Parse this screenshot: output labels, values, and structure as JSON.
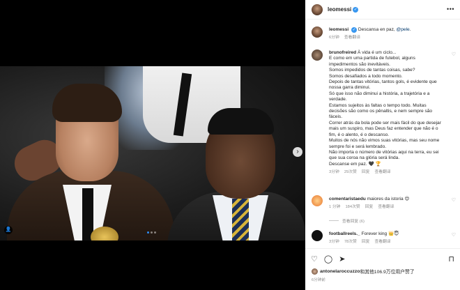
{
  "post_author": {
    "username": "leomessi",
    "verified": true
  },
  "header": {
    "more_icon": "more-horizontal-icon"
  },
  "media": {
    "next_icon": "chevron-right-icon",
    "tag_icon": "user-tag-icon",
    "slide_count": 3,
    "active_slide": 1
  },
  "caption": {
    "username": "leomessi",
    "text": "Descansa en paz, ",
    "mention": "@pele",
    "text_end": ".",
    "time": "6分钟",
    "translate": "查看翻译"
  },
  "comments": [
    {
      "username": "brunofreired",
      "lines": [
        "À vida é um ciclo...",
        "E como em uma partida de futebol, alguns",
        "impedimentos são inevitáveis.",
        "Somos impedidos de tantas coisas, sabe?",
        "Somos desafiados a todo momento.",
        "Depois de tantas vitórias, tantos gols, é evidente que",
        "nossa garra diminui.",
        "Só que isso não diminui a história, a trajetória e a",
        "verdade.",
        "Estamos sujeitos às faltas o tempo todo. Muitas",
        "decisões são como os pênaltis, e nem sempre são",
        "fáceis.",
        "Correr atrás da bola pode ser mais fácil do que desejar",
        "mais um suspiro, mas Deus faz entender que não é o",
        "fim, é o alento, é o descanso.",
        "Muitos de nós não vimos suas vitórias, mas seu nome",
        "sempre foi e será lembrado.",
        "Não importa o número de vitórias aqui na terra, eu sei",
        "que sua coroa na glória será linda.",
        "Descanse em paz. 🖤 🏆"
      ],
      "time": "3分钟",
      "likes": "29次赞",
      "reply": "回复",
      "translate": "查看翻译"
    },
    {
      "username": "comentaristaedu",
      "text": "maiores da istoria 😍",
      "time": "1 分钟",
      "likes": "184次赞",
      "reply": "回复",
      "translate": "查看翻译",
      "replies_label": "查看回复 (6)"
    },
    {
      "username": "footballreels._",
      "text": "Forever king 👑😇",
      "time": "3分钟",
      "likes": "78次赞",
      "reply": "回复",
      "translate": "查看翻译"
    }
  ],
  "actions": {
    "like_icon": "heart-icon",
    "comment_icon": "comment-icon",
    "share_icon": "share-icon",
    "save_icon": "bookmark-icon"
  },
  "likes_summary": {
    "user": "antonelaroccuzzo",
    "text": "和其他106.9万位用户赞了"
  },
  "post_time": "6分钟前"
}
